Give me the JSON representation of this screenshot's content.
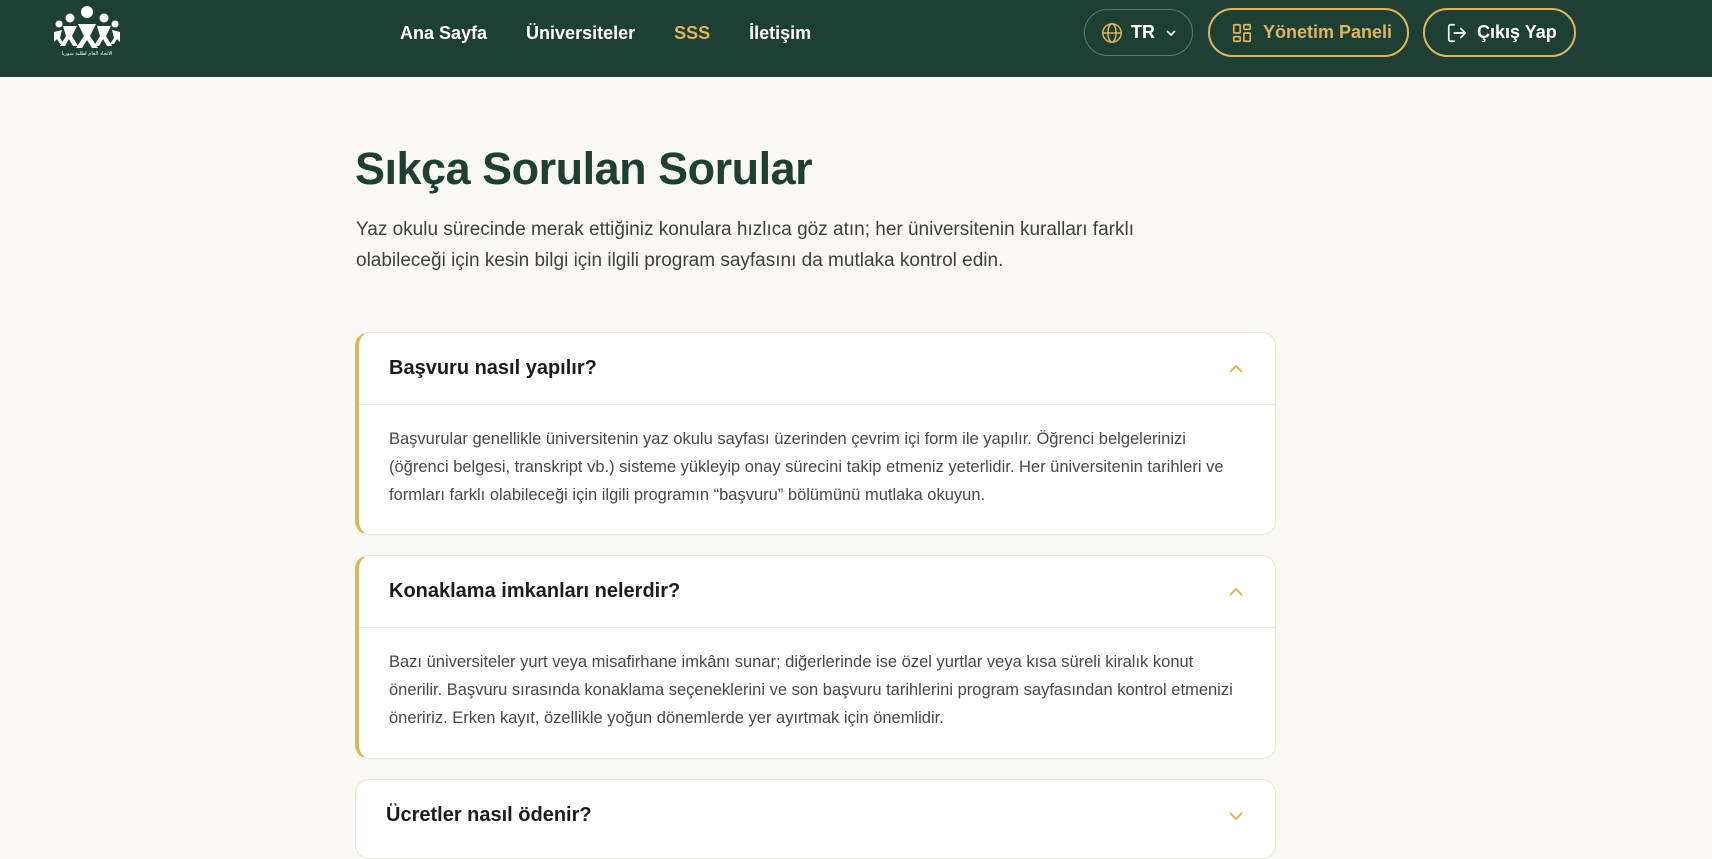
{
  "navbar": {
    "logo_caption": "الاتحاد العام لطلبة سوريا",
    "links": [
      {
        "label": "Ana Sayfa"
      },
      {
        "label": "Üniversiteler"
      },
      {
        "label": "SSS"
      },
      {
        "label": "İletişim"
      }
    ],
    "active_link": "SSS",
    "language": {
      "label": "TR",
      "icon": "globe-icon"
    },
    "dashboard_button": {
      "label": "Yönetim Paneli",
      "icon": "dashboard-icon"
    },
    "logout_button": {
      "label": "Çıkış Yap",
      "icon": "logout-icon"
    }
  },
  "page": {
    "title": "Sıkça Sorulan Sorular",
    "intro": "Yaz okulu sürecinde merak ettiğiniz konulara hızlıca göz atın; her üniversitenin kuralları farklı olabileceği için kesin bilgi için ilgili program sayfasını da mutlaka kontrol edin."
  },
  "faq": [
    {
      "question": "Başvuru nasıl yapılır?",
      "answer": "Başvurular genellikle üniversitenin yaz okulu sayfası üzerinden çevrim içi form ile yapılır. Öğrenci belgelerinizi (öğrenci belgesi, transkript vb.) sisteme yükleyip onay sürecini takip etmeniz yeterlidir. Her üniversitenin tarihleri ve formları farklı olabileceği için ilgili programın “başvuru” bölümünü mutlaka okuyun.",
      "expanded": true
    },
    {
      "question": "Konaklama imkanları nelerdir?",
      "answer": "Bazı üniversiteler yurt veya misafirhane imkânı sunar; diğerlerinde ise özel yurtlar veya kısa süreli kiralık konut önerilir. Başvuru sırasında konaklama seçeneklerini ve son başvuru tarihlerini program sayfasından kontrol etmenizi öneririz. Erken kayıt, özellikle yoğun dönemlerde yer ayırtmak için önemlidir.",
      "expanded": true
    },
    {
      "question": "Ücretler nasıl ödenir?",
      "expanded": false
    }
  ],
  "colors": {
    "navbar_bg": "#1e4034",
    "accent": "#e0b658",
    "page_bg": "#f9f8f4",
    "title": "#1e4034"
  }
}
